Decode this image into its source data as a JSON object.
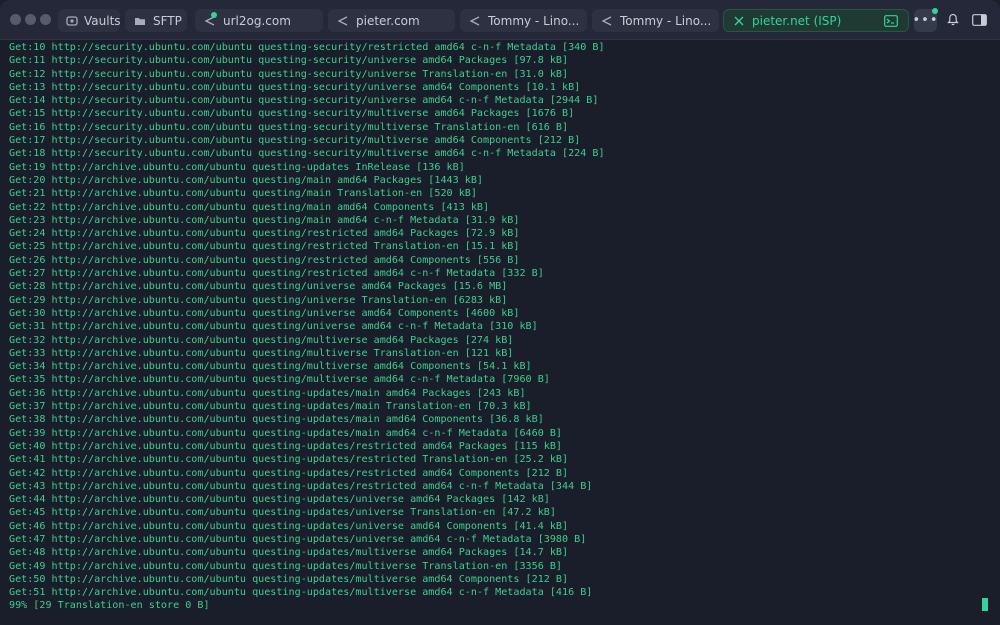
{
  "tabs": [
    {
      "label": "Vaults",
      "icon": "vault-icon"
    },
    {
      "label": "SFTP",
      "icon": "folder-icon"
    },
    {
      "label": "url2og.com",
      "icon": "host-icon"
    },
    {
      "label": "pieter.com",
      "icon": "host-icon"
    },
    {
      "label": "Tommy - Lino...",
      "icon": "host-icon"
    },
    {
      "label": "Tommy - Lino...",
      "icon": "host-icon"
    },
    {
      "label": "pieter.net (ISP)",
      "icon": "close-icon",
      "active": true
    }
  ],
  "colors": {
    "accent": "#34d399",
    "terminal_text": "#3ecf8e",
    "background": "#1a1d2a"
  },
  "terminal": {
    "lines": [
      "Get:10 http://security.ubuntu.com/ubuntu questing-security/restricted amd64 c-n-f Metadata [340 B]",
      "Get:11 http://security.ubuntu.com/ubuntu questing-security/universe amd64 Packages [97.8 kB]",
      "Get:12 http://security.ubuntu.com/ubuntu questing-security/universe Translation-en [31.0 kB]",
      "Get:13 http://security.ubuntu.com/ubuntu questing-security/universe amd64 Components [10.1 kB]",
      "Get:14 http://security.ubuntu.com/ubuntu questing-security/universe amd64 c-n-f Metadata [2944 B]",
      "Get:15 http://security.ubuntu.com/ubuntu questing-security/multiverse amd64 Packages [1676 B]",
      "Get:16 http://security.ubuntu.com/ubuntu questing-security/multiverse Translation-en [616 B]",
      "Get:17 http://security.ubuntu.com/ubuntu questing-security/multiverse amd64 Components [212 B]",
      "Get:18 http://security.ubuntu.com/ubuntu questing-security/multiverse amd64 c-n-f Metadata [224 B]",
      "Get:19 http://archive.ubuntu.com/ubuntu questing-updates InRelease [136 kB]",
      "Get:20 http://archive.ubuntu.com/ubuntu questing/main amd64 Packages [1443 kB]",
      "Get:21 http://archive.ubuntu.com/ubuntu questing/main Translation-en [520 kB]",
      "Get:22 http://archive.ubuntu.com/ubuntu questing/main amd64 Components [413 kB]",
      "Get:23 http://archive.ubuntu.com/ubuntu questing/main amd64 c-n-f Metadata [31.9 kB]",
      "Get:24 http://archive.ubuntu.com/ubuntu questing/restricted amd64 Packages [72.9 kB]",
      "Get:25 http://archive.ubuntu.com/ubuntu questing/restricted Translation-en [15.1 kB]",
      "Get:26 http://archive.ubuntu.com/ubuntu questing/restricted amd64 Components [556 B]",
      "Get:27 http://archive.ubuntu.com/ubuntu questing/restricted amd64 c-n-f Metadata [332 B]",
      "Get:28 http://archive.ubuntu.com/ubuntu questing/universe amd64 Packages [15.6 MB]",
      "Get:29 http://archive.ubuntu.com/ubuntu questing/universe Translation-en [6283 kB]",
      "Get:30 http://archive.ubuntu.com/ubuntu questing/universe amd64 Components [4600 kB]",
      "Get:31 http://archive.ubuntu.com/ubuntu questing/universe amd64 c-n-f Metadata [310 kB]",
      "Get:32 http://archive.ubuntu.com/ubuntu questing/multiverse amd64 Packages [274 kB]",
      "Get:33 http://archive.ubuntu.com/ubuntu questing/multiverse Translation-en [121 kB]",
      "Get:34 http://archive.ubuntu.com/ubuntu questing/multiverse amd64 Components [54.1 kB]",
      "Get:35 http://archive.ubuntu.com/ubuntu questing/multiverse amd64 c-n-f Metadata [7960 B]",
      "Get:36 http://archive.ubuntu.com/ubuntu questing-updates/main amd64 Packages [243 kB]",
      "Get:37 http://archive.ubuntu.com/ubuntu questing-updates/main Translation-en [70.3 kB]",
      "Get:38 http://archive.ubuntu.com/ubuntu questing-updates/main amd64 Components [36.8 kB]",
      "Get:39 http://archive.ubuntu.com/ubuntu questing-updates/main amd64 c-n-f Metadata [6460 B]",
      "Get:40 http://archive.ubuntu.com/ubuntu questing-updates/restricted amd64 Packages [115 kB]",
      "Get:41 http://archive.ubuntu.com/ubuntu questing-updates/restricted Translation-en [25.2 kB]",
      "Get:42 http://archive.ubuntu.com/ubuntu questing-updates/restricted amd64 Components [212 B]",
      "Get:43 http://archive.ubuntu.com/ubuntu questing-updates/restricted amd64 c-n-f Metadata [344 B]",
      "Get:44 http://archive.ubuntu.com/ubuntu questing-updates/universe amd64 Packages [142 kB]",
      "Get:45 http://archive.ubuntu.com/ubuntu questing-updates/universe Translation-en [47.2 kB]",
      "Get:46 http://archive.ubuntu.com/ubuntu questing-updates/universe amd64 Components [41.4 kB]",
      "Get:47 http://archive.ubuntu.com/ubuntu questing-updates/universe amd64 c-n-f Metadata [3980 B]",
      "Get:48 http://archive.ubuntu.com/ubuntu questing-updates/multiverse amd64 Packages [14.7 kB]",
      "Get:49 http://archive.ubuntu.com/ubuntu questing-updates/multiverse Translation-en [3356 B]",
      "Get:50 http://archive.ubuntu.com/ubuntu questing-updates/multiverse amd64 Components [212 B]",
      "Get:51 http://archive.ubuntu.com/ubuntu questing-updates/multiverse amd64 c-n-f Metadata [416 B]",
      "99% [29 Translation-en store 0 B]"
    ]
  }
}
